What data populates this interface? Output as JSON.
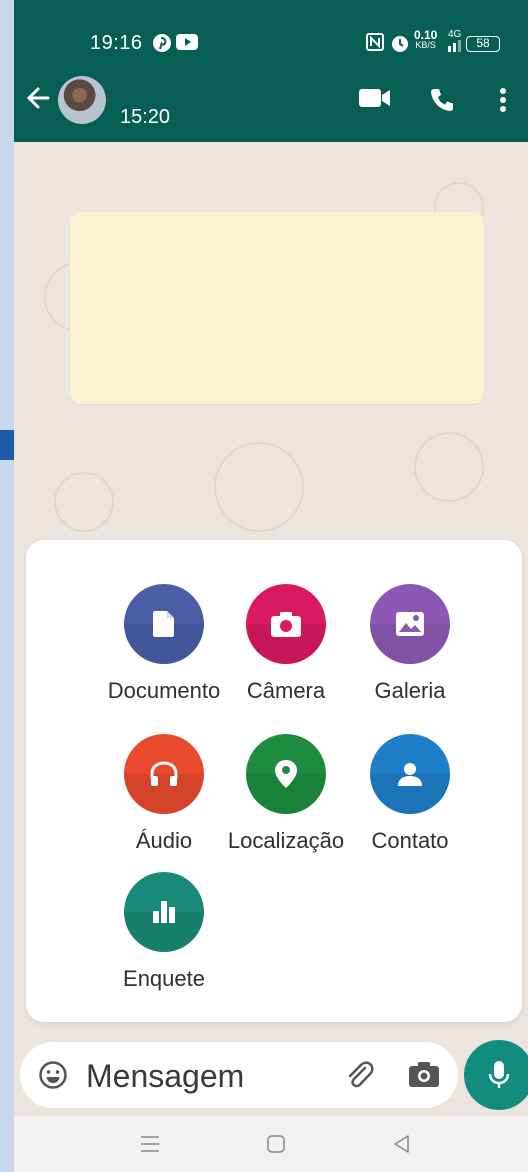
{
  "status_bar": {
    "time": "19:16",
    "net_speed": "0.10",
    "net_unit": "KB/S",
    "network_type": "4G",
    "battery": "58",
    "icons": [
      "pinterest-icon",
      "youtube-icon",
      "nfc-icon",
      "alarm-icon",
      "signal-icon",
      "battery-icon"
    ]
  },
  "header": {
    "chat_time": "15:20",
    "icons": [
      "back-arrow-icon",
      "avatar",
      "video-call-icon",
      "voice-call-icon",
      "more-vert-icon"
    ]
  },
  "attach_options": [
    {
      "label": "Documento",
      "color": "#4a5ea8",
      "icon": "document-icon"
    },
    {
      "label": "Câmera",
      "color": "#d91a5f",
      "icon": "camera-icon"
    },
    {
      "label": "Galeria",
      "color": "#8c58b4",
      "icon": "gallery-icon"
    },
    {
      "label": "Áudio",
      "color": "#e8492d",
      "icon": "headphones-icon"
    },
    {
      "label": "Localização",
      "color": "#1d8c3e",
      "icon": "location-pin-icon"
    },
    {
      "label": "Contato",
      "color": "#1f7ec8",
      "icon": "contact-icon"
    },
    {
      "label": "Enquete",
      "color": "#1a8a78",
      "icon": "poll-icon"
    }
  ],
  "input": {
    "placeholder": "Mensagem"
  },
  "colors": {
    "header": "#075e54",
    "wallpaper": "#ece5dd",
    "message_bubble": "#fbf0cf",
    "mic_button": "#128c7e"
  }
}
